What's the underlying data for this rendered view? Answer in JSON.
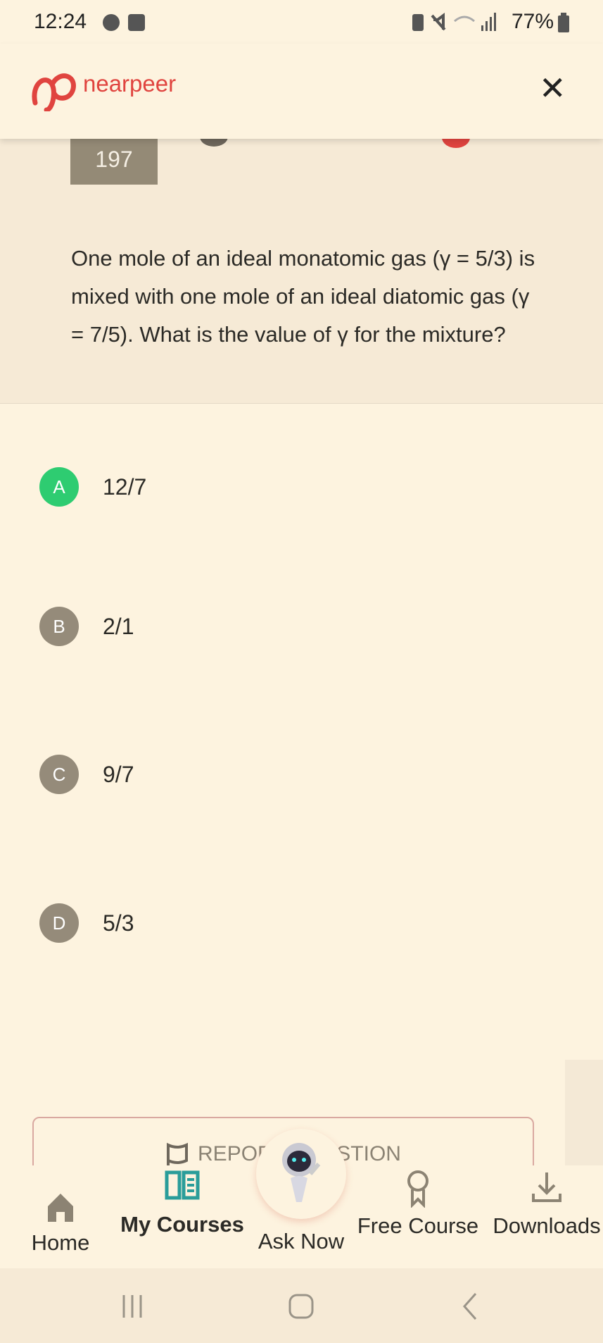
{
  "status_bar": {
    "time": "12:24",
    "battery": "77%"
  },
  "header": {
    "brand": "nearpeer",
    "close_label": "✕"
  },
  "question": {
    "number": "197",
    "text": "One mole of an ideal monatomic gas (γ = 5/3) is mixed with one mole of an ideal diatomic gas (γ = 7/5). What is the value of γ for the mixture?"
  },
  "options": [
    {
      "letter": "A",
      "text": "12/7",
      "state": "correct"
    },
    {
      "letter": "B",
      "text": "2/1"
    },
    {
      "letter": "C",
      "text": "9/7"
    },
    {
      "letter": "D",
      "text": "5/3"
    }
  ],
  "report_label": "REPORT QUESTION",
  "nav": {
    "items": [
      {
        "label": "Home",
        "icon": "home-icon"
      },
      {
        "label": "My Courses",
        "icon": "book-icon",
        "active": true
      },
      {
        "label": "Ask Now",
        "icon": "robot-icon"
      },
      {
        "label": "Free Course",
        "icon": "award-icon"
      },
      {
        "label": "Downloads",
        "icon": "download-icon"
      }
    ]
  },
  "colors": {
    "brand": "#e0443f",
    "correct": "#2ecc71",
    "active": "#2a9d9a"
  }
}
